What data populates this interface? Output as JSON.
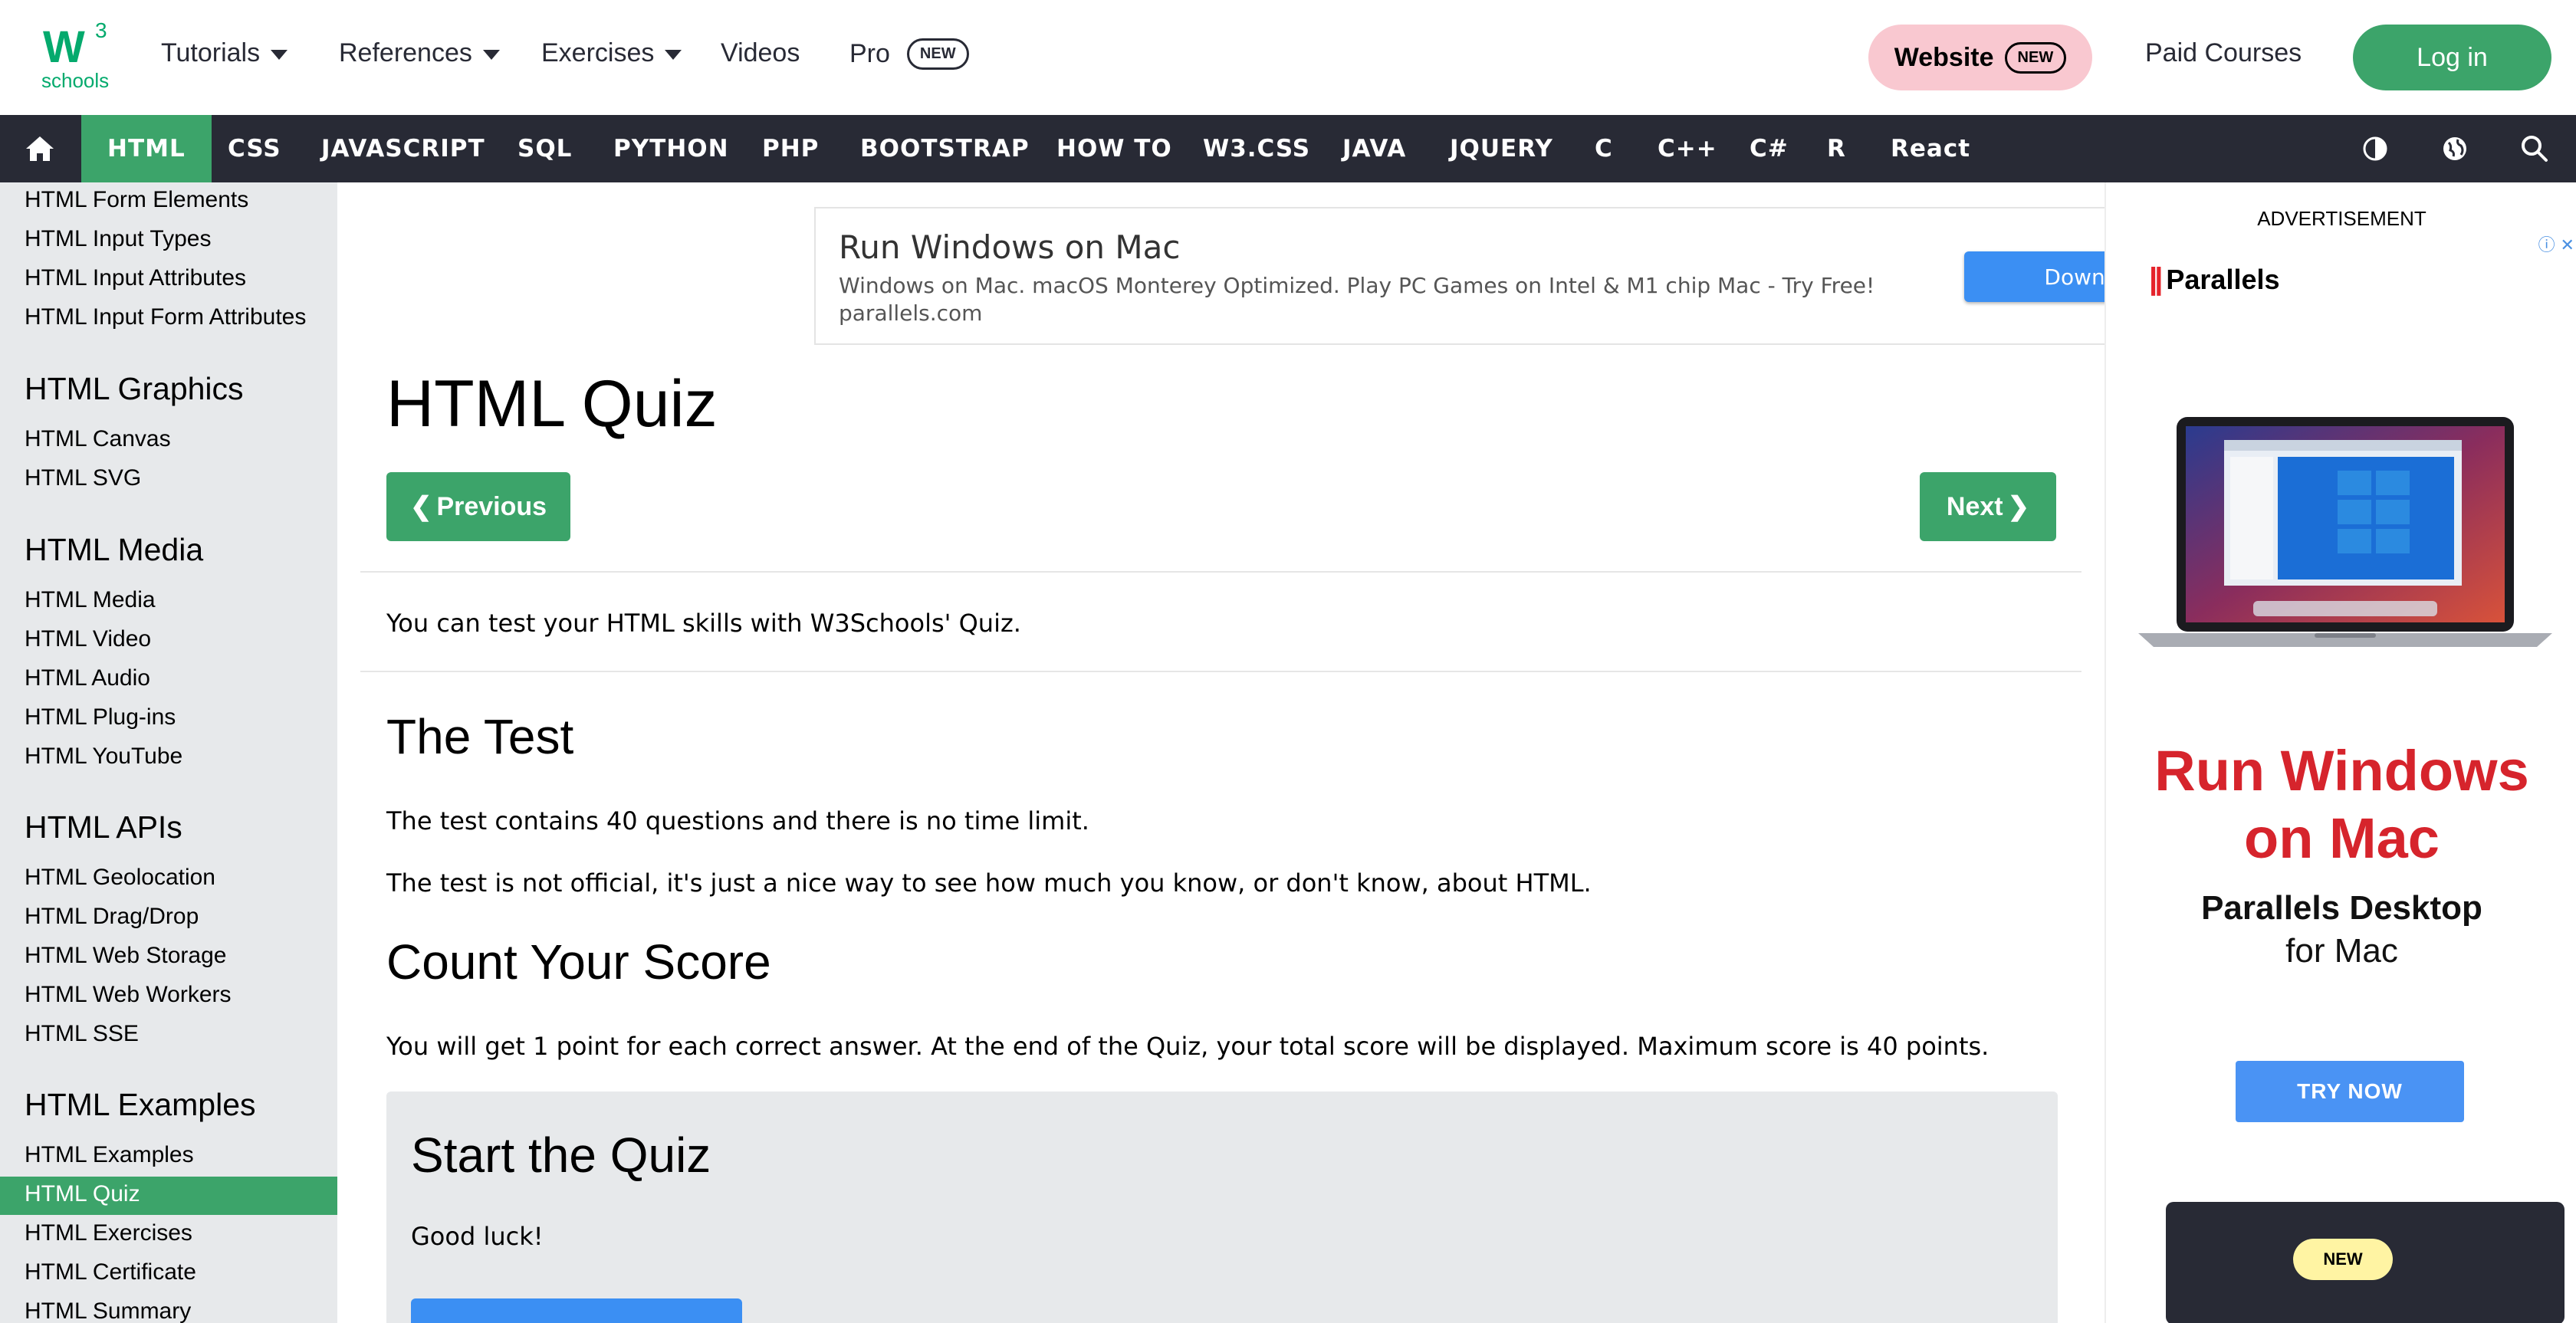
{
  "logo": {
    "main": "W",
    "sup": "3",
    "sub": "schools"
  },
  "topnav": {
    "tutorials": "Tutorials",
    "references": "References",
    "exercises": "Exercises",
    "videos": "Videos",
    "pro": "Pro",
    "pro_badge": "NEW",
    "website": "Website",
    "website_badge": "NEW",
    "paid_courses": "Paid Courses",
    "login": "Log in"
  },
  "darknav": {
    "items": [
      "HTML",
      "CSS",
      "JAVASCRIPT",
      "SQL",
      "PYTHON",
      "PHP",
      "BOOTSTRAP",
      "HOW TO",
      "W3.CSS",
      "JAVA",
      "JQUERY",
      "C",
      "C++",
      "C#",
      "R",
      "React"
    ],
    "active": "HTML",
    "icons": [
      "home-icon",
      "contrast-icon",
      "globe-icon",
      "search-icon"
    ]
  },
  "sidebar": {
    "links_top": [
      "HTML Form Elements",
      "HTML Input Types",
      "HTML Input Attributes",
      "HTML Input Form Attributes"
    ],
    "graphics_heading": "HTML Graphics",
    "graphics": [
      "HTML Canvas",
      "HTML SVG"
    ],
    "media_heading": "HTML Media",
    "media": [
      "HTML Media",
      "HTML Video",
      "HTML Audio",
      "HTML Plug-ins",
      "HTML YouTube"
    ],
    "apis_heading": "HTML APIs",
    "apis": [
      "HTML Geolocation",
      "HTML Drag/Drop",
      "HTML Web Storage",
      "HTML Web Workers",
      "HTML SSE"
    ],
    "examples_heading": "HTML Examples",
    "examples": [
      "HTML Examples",
      "HTML Quiz",
      "HTML Exercises",
      "HTML Certificate",
      "HTML Summary"
    ],
    "active": "HTML Quiz"
  },
  "ad_top": {
    "title": "Run Windows on Mac",
    "desc": "Windows on Mac. macOS Monterey Optimized. Play PC Games on Intel & M1 chip Mac - Try Free!",
    "domain": "parallels.com",
    "button": "Download"
  },
  "main": {
    "title": "HTML Quiz",
    "prev": "Previous",
    "next": "Next",
    "intro": "You can test your HTML skills with W3Schools' Quiz.",
    "test_heading": "The Test",
    "test_p1": "The test contains 40 questions and there is no time limit.",
    "test_p2": "The test is not official, it's just a nice way to see how much you know, or don't know, about HTML.",
    "score_heading": "Count Your Score",
    "score_p": "You will get 1 point for each correct answer. At the end of the Quiz, your total score will be displayed. Maximum score is 40 points.",
    "quiz_heading": "Start the Quiz",
    "quiz_p": "Good luck!"
  },
  "right_ad": {
    "label": "ADVERTISEMENT",
    "brand": "Parallels",
    "headline_1": "Run Windows",
    "headline_2": "on Mac",
    "product": "Parallels Desktop",
    "product_sup": "®",
    "for_mac": "for Mac",
    "cta": "TRY NOW",
    "new_badge": "NEW"
  }
}
